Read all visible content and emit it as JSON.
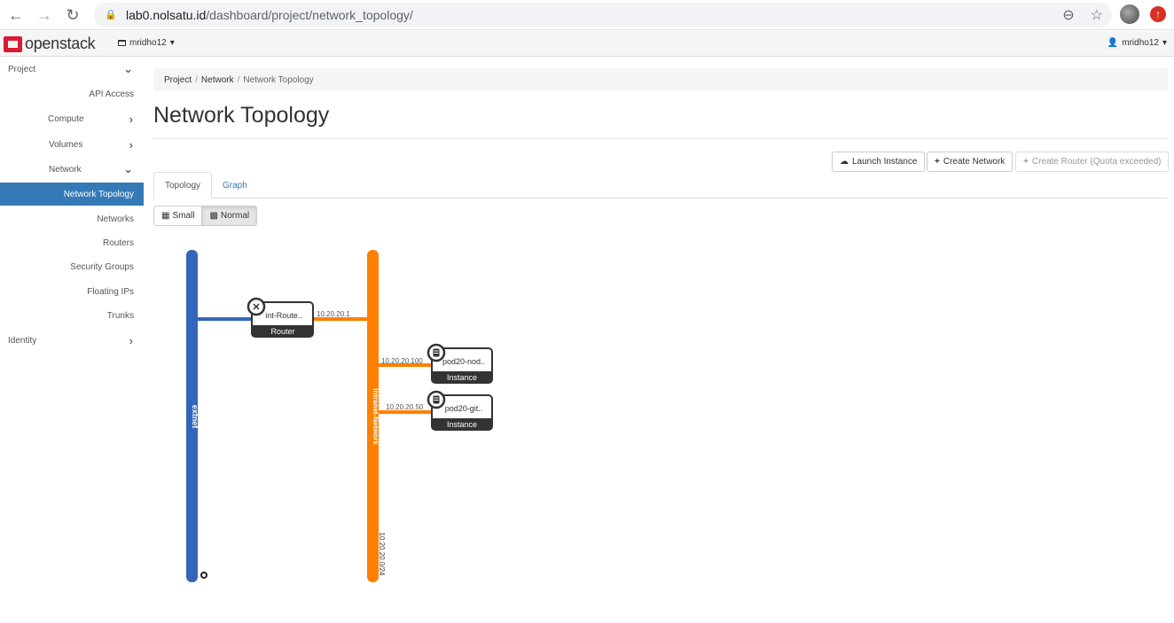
{
  "browser": {
    "url_host": "lab0.nolsatu.id",
    "url_path": "/dashboard/project/network_topology/"
  },
  "topbar": {
    "logo_text": "openstack",
    "project": "mridho12",
    "user": "mridho12"
  },
  "sidebar": {
    "items": [
      {
        "label": "Project",
        "chevron": "down"
      },
      {
        "label": "API Access"
      },
      {
        "label": "Compute",
        "chevron": "right"
      },
      {
        "label": "Volumes",
        "chevron": "right"
      },
      {
        "label": "Network",
        "chevron": "down"
      },
      {
        "label": "Network Topology",
        "active": true
      },
      {
        "label": "Networks"
      },
      {
        "label": "Routers"
      },
      {
        "label": "Security Groups"
      },
      {
        "label": "Floating IPs"
      },
      {
        "label": "Trunks"
      },
      {
        "label": "Identity",
        "chevron": "right"
      }
    ]
  },
  "breadcrumb": {
    "project": "Project",
    "network": "Network",
    "current": "Network Topology"
  },
  "page": {
    "title": "Network Topology"
  },
  "actions": {
    "launch_instance": "Launch Instance",
    "create_network": "Create Network",
    "create_router": "Create Router (Quota exceeded)"
  },
  "tabs": {
    "topology": "Topology",
    "graph": "Graph"
  },
  "size": {
    "small": "Small",
    "normal": "Normal"
  },
  "topology": {
    "colors": {
      "extnet": "#3366bb",
      "intranet": "#ff8000",
      "node_border": "#333333"
    },
    "networks": {
      "extnet": {
        "name": "extnet"
      },
      "intranet": {
        "name": "Intranet-Network",
        "cidr": "10.20.20.0/24"
      }
    },
    "router": {
      "name": "int-Route..",
      "type": "Router",
      "ip": "10.20.20.1"
    },
    "instances": [
      {
        "name": "pod20-nod..",
        "type": "Instance",
        "ip": "10.20.20.100"
      },
      {
        "name": "pod20-git..",
        "type": "Instance",
        "ip": "10.20.20.50"
      }
    ]
  }
}
